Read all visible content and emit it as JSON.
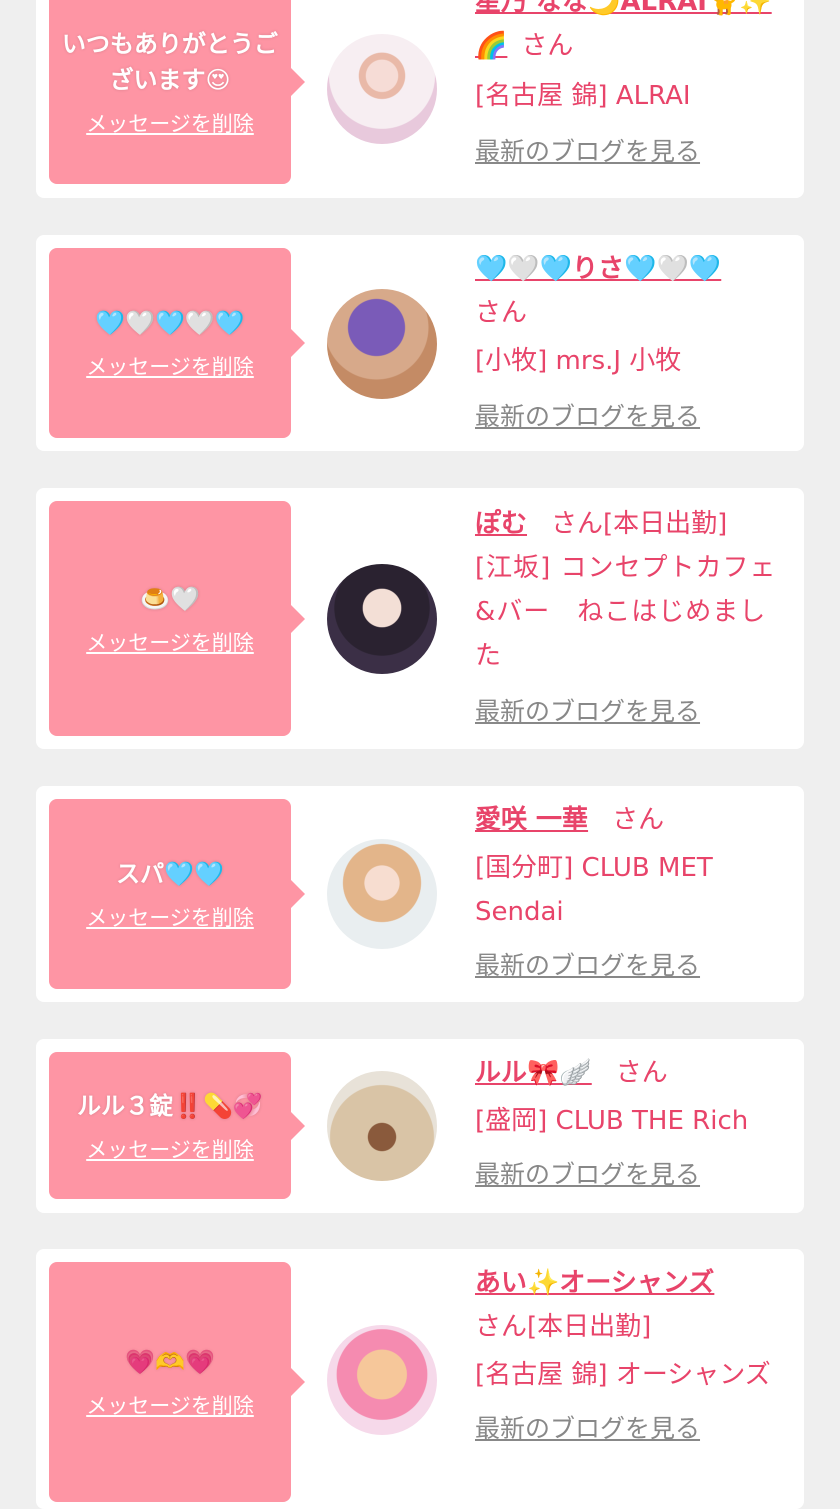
{
  "colors": {
    "accent": "#e8446a",
    "bubble": "#fe95a4",
    "background": "#efefef",
    "blog_link": "#888888"
  },
  "delete_label": "メッセージを削除",
  "san": "さん",
  "blog_label": "最新のブログを見る",
  "cards": [
    {
      "message": "いつもありがとうございます😍",
      "name": "星乃 なな🌙ALRAI🐈✨🌈",
      "status": "",
      "shop": "[名古屋 錦] ALRAI"
    },
    {
      "message": "🩵🤍🩵🤍🩵",
      "name": "🩵🤍🩵りさ🩵🤍🩵",
      "status": "",
      "shop": "[小牧] mrs.J 小牧"
    },
    {
      "message": "🍮🤍",
      "name": "ぽむ",
      "status": "[本日出勤]",
      "shop": "[江坂] コンセプトカフェ&バー　ねこはじめました"
    },
    {
      "message": "スパ🩵🩵",
      "name": "愛咲 一華",
      "status": "",
      "shop": "[国分町] CLUB MET Sendai"
    },
    {
      "message": "ルル３錠‼️💊💞",
      "name": "ルル🎀🪽",
      "status": "",
      "shop": "[盛岡] CLUB THE Rich"
    },
    {
      "message": "💗🫶💗",
      "name": "あい✨オーシャンズ",
      "status": "[本日出勤]",
      "shop": "[名古屋 錦] オーシャンズ"
    }
  ]
}
